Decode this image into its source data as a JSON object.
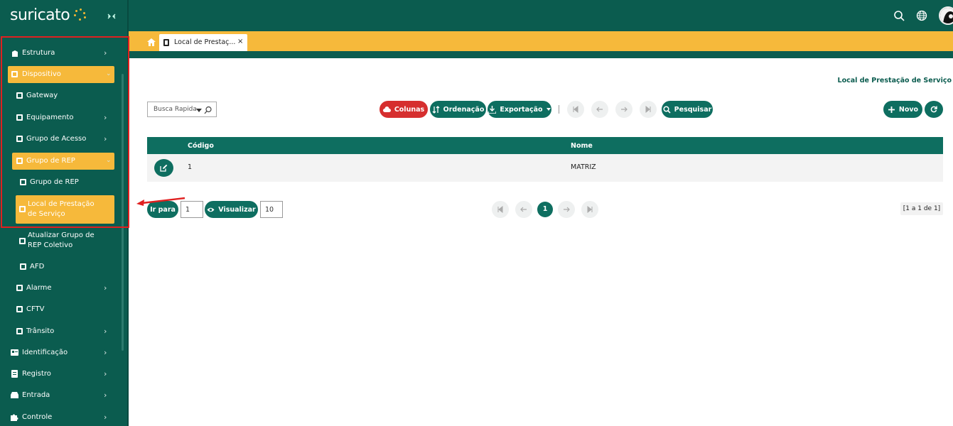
{
  "app": {
    "logo_text": "suricato"
  },
  "sidebar": {
    "items": [
      {
        "label": "Estrutura"
      },
      {
        "label": "Dispositivo"
      },
      {
        "label": "Gateway"
      },
      {
        "label": "Equipamento"
      },
      {
        "label": "Grupo de Acesso"
      },
      {
        "label": "Grupo de REP"
      },
      {
        "label": "Grupo de REP"
      },
      {
        "label_line1": "Local de Prestação",
        "label_line2": "de Serviço"
      },
      {
        "label_line1": "Atualizar Grupo de",
        "label_line2": "REP Coletivo"
      },
      {
        "label": "AFD"
      },
      {
        "label": "Alarme"
      },
      {
        "label": "CFTV"
      },
      {
        "label": "Trânsito"
      },
      {
        "label": "Identificação"
      },
      {
        "label": "Registro"
      },
      {
        "label": "Entrada"
      },
      {
        "label": "Controle"
      }
    ]
  },
  "tabs": [
    {
      "label": "Local de Prestaç...",
      "close": "×"
    }
  ],
  "page": {
    "title": "Local de Prestação de Serviço"
  },
  "toolbar": {
    "quick_search": "Busca Rapida",
    "columns": "Colunas",
    "sort": "Ordenação",
    "export": "Exportação",
    "search": "Pesquisar",
    "new": "Novo"
  },
  "table": {
    "columns": [
      "Código",
      "Nome"
    ],
    "rows": [
      [
        "1",
        "MATRIZ"
      ]
    ]
  },
  "pagination": {
    "goto_label": "Ir para",
    "goto_value": "1",
    "view_label": "Visualizar",
    "per_page": "10",
    "current_page": "1",
    "info": "[1 a 1 de 1]"
  },
  "colors": {
    "primary": "#0b5c4f",
    "accent": "#f6b93b",
    "danger": "#d62f2f"
  }
}
